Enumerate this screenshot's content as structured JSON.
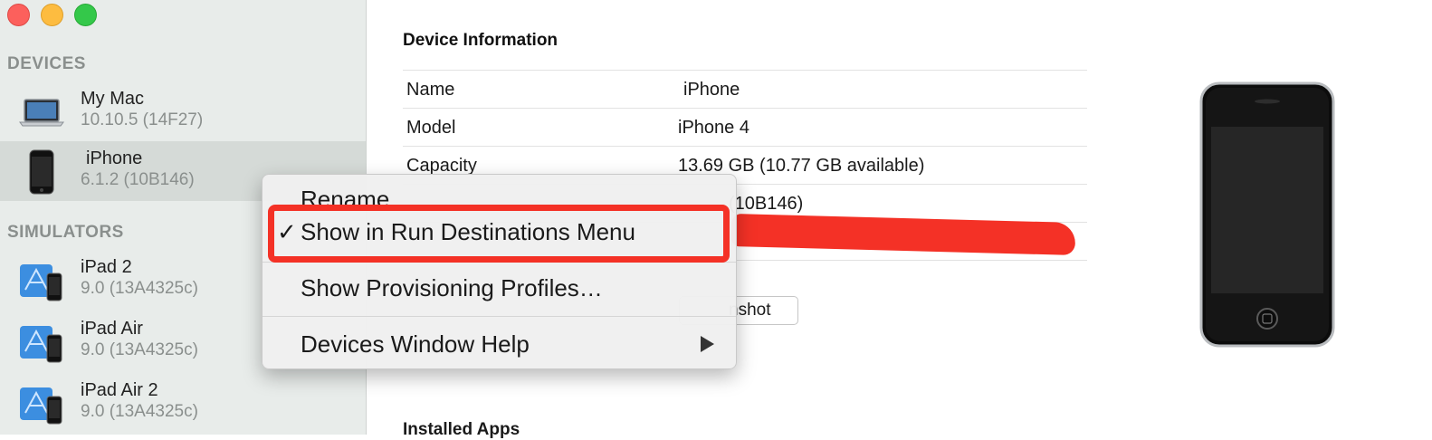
{
  "sidebar": {
    "devices_header": "DEVICES",
    "simulators_header": "SIMULATORS",
    "devices": [
      {
        "name": "My Mac",
        "version": "10.10.5 (14F27)",
        "icon": "macbook-icon"
      },
      {
        "name": "iPhone",
        "version": "6.1.2 (10B146)",
        "icon": "iphone-icon",
        "selected": true
      }
    ],
    "simulators": [
      {
        "name": "iPad 2",
        "version": "9.0 (13A4325c)",
        "icon": "simulator-icon"
      },
      {
        "name": "iPad Air",
        "version": "9.0 (13A4325c)",
        "icon": "simulator-icon"
      },
      {
        "name": "iPad Air 2",
        "version": "9.0 (13A4325c)",
        "icon": "simulator-icon"
      }
    ]
  },
  "main": {
    "device_info_title": "Device Information",
    "rows": [
      {
        "key": "Name",
        "value": "iPhone"
      },
      {
        "key": "Model",
        "value": "iPhone 4"
      },
      {
        "key": "Capacity",
        "value": "13.69 GB (10.77 GB available)"
      },
      {
        "key": "",
        "value": "(10B146)"
      },
      {
        "key": "",
        "value": ""
      }
    ],
    "screenshot_button": "nshot",
    "installed_apps": "Installed Apps"
  },
  "context_menu": {
    "items": [
      {
        "label": "Rename",
        "checked": false
      },
      {
        "label": "Show in Run Destinations Menu",
        "checked": true
      },
      {
        "label": "Show Provisioning Profiles…",
        "checked": false
      },
      {
        "label": "Devices Window Help",
        "submenu": true
      }
    ],
    "checkmark": "✓"
  },
  "colors": {
    "annotation_red": "#f43126",
    "sidebar_bg": "#e8ecea",
    "selected_bg": "#d5dad7"
  }
}
